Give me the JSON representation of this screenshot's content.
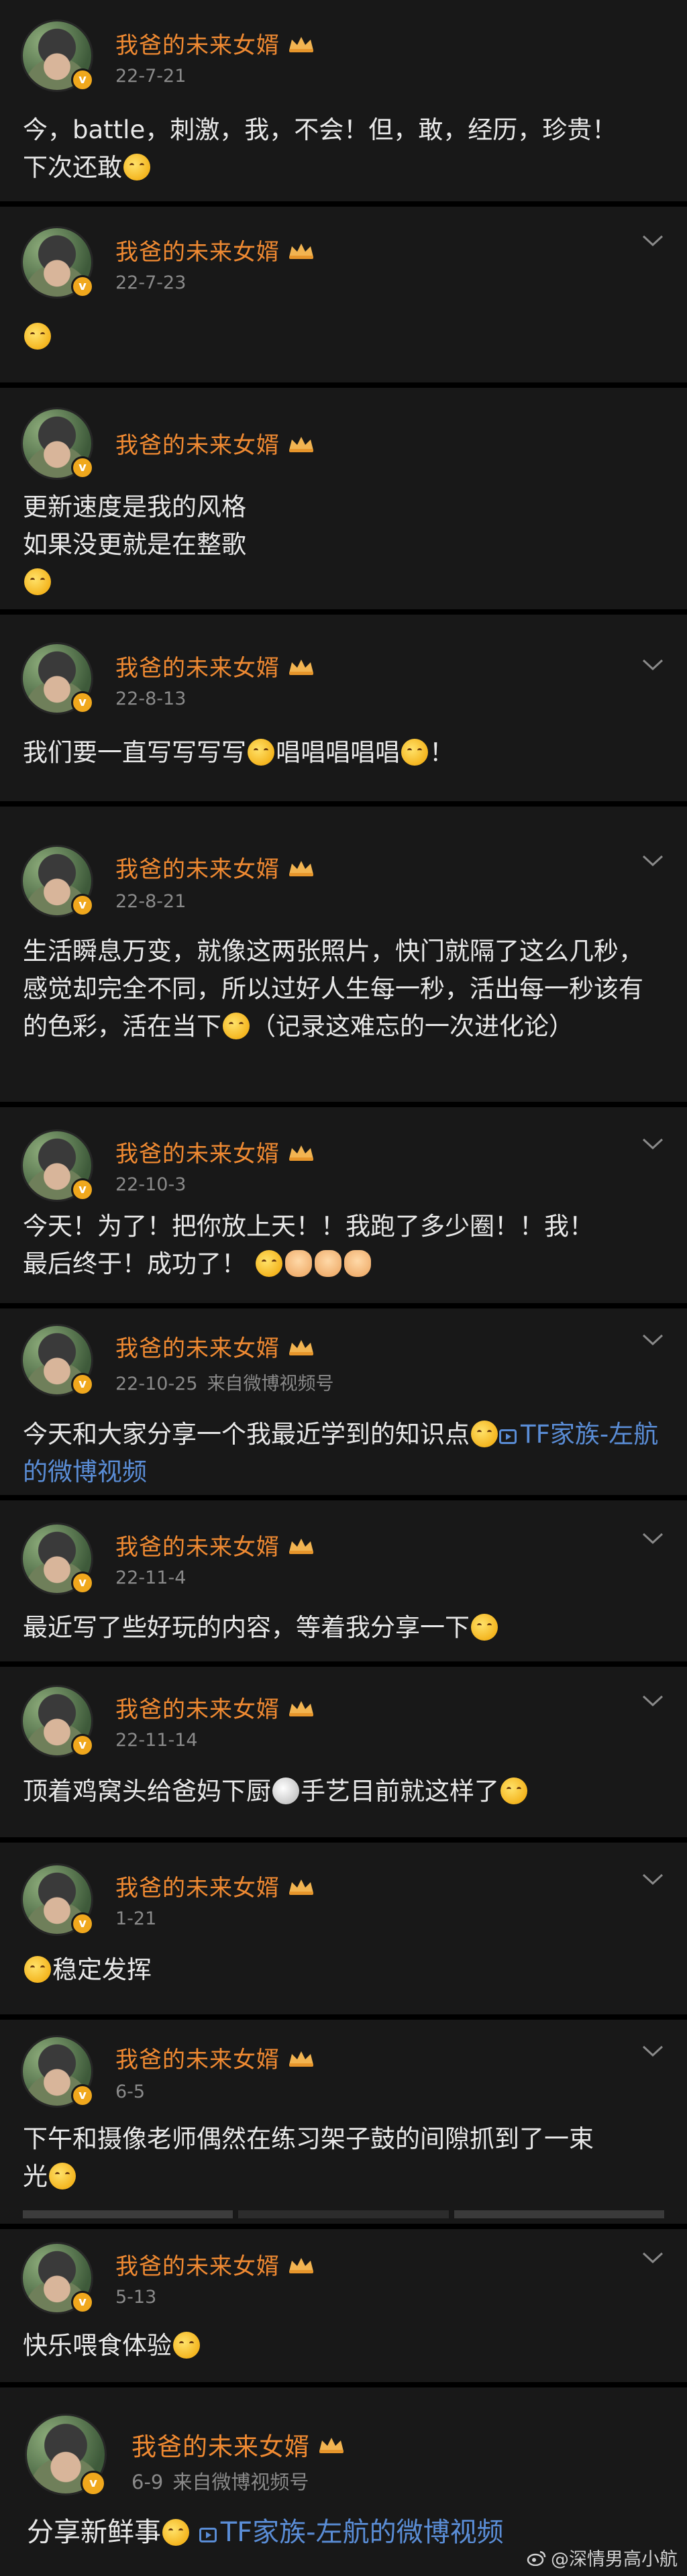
{
  "author_name": "我爸的未来女婿",
  "posts": [
    {
      "date": "22-7-21",
      "source": "",
      "text": "今，battle，刺激，我，不会！但，敢，经历，珍贵！\n下次还敢",
      "tail": "",
      "has_chevron": false
    },
    {
      "date": "22-7-23",
      "source": "",
      "text": "",
      "tail": "",
      "has_chevron": true
    },
    {
      "date": "",
      "source": "",
      "text": "更新速度是我的风格\n如果没更就是在整歌",
      "tail": "",
      "has_chevron": false
    },
    {
      "date": "22-8-13",
      "source": "",
      "text": "我们要一直写写写写",
      "text_mid": "唱唱唱唱唱",
      "tail": "！",
      "has_chevron": true
    },
    {
      "date": "22-8-21",
      "source": "",
      "text": "生活瞬息万变，就像这两张照片，快门就隔了这么几秒，感觉却完全不同，所以过好人生每一秒，活出每一秒该有的色彩，活在当下",
      "tail": "（记录这难忘的一次进化论）",
      "has_chevron": true
    },
    {
      "date": "22-10-3",
      "source": "",
      "text": "今天！为了！把你放上天！！我跑了多少圈！！我！\n最后终于！成功了！",
      "tail": "",
      "has_chevron": true
    },
    {
      "date": "22-10-25",
      "source": "来自微博视频号",
      "text": "今天和大家分享一个我最近学到的知识点",
      "link": "TF家族-左航的微博视频",
      "tail": "",
      "has_chevron": true
    },
    {
      "date": "22-11-4",
      "source": "",
      "text": "最近写了些好玩的内容，等着我分享一下",
      "tail": "",
      "has_chevron": true
    },
    {
      "date": "22-11-14",
      "source": "",
      "text": "顶着鸡窝头给爸妈下厨",
      "tail": "手艺目前就这样了",
      "has_chevron": true
    },
    {
      "date": "1-21",
      "source": "",
      "text": "稳定发挥",
      "tail": "",
      "has_chevron": true
    },
    {
      "date": "6-5",
      "source": "",
      "text": "下午和摄像老师偶然在练习架子鼓的间隙抓到了一束\n光",
      "tail": "",
      "has_chevron": true
    },
    {
      "date": "5-13",
      "source": "",
      "text": "快乐喂食体验",
      "tail": "",
      "has_chevron": true
    },
    {
      "date": "6-9",
      "source": "来自微博视频号",
      "text": "分享新鲜事",
      "link": "TF家族-左航的微博视频",
      "tail": "",
      "has_chevron": false
    }
  ],
  "watermark": "@深情男高小航",
  "colors": {
    "background": "#000000",
    "card": "#181818",
    "name": "#f08a32",
    "meta": "#8a8a8a",
    "link": "#5a8dd6",
    "badge": "#f0a81d"
  }
}
